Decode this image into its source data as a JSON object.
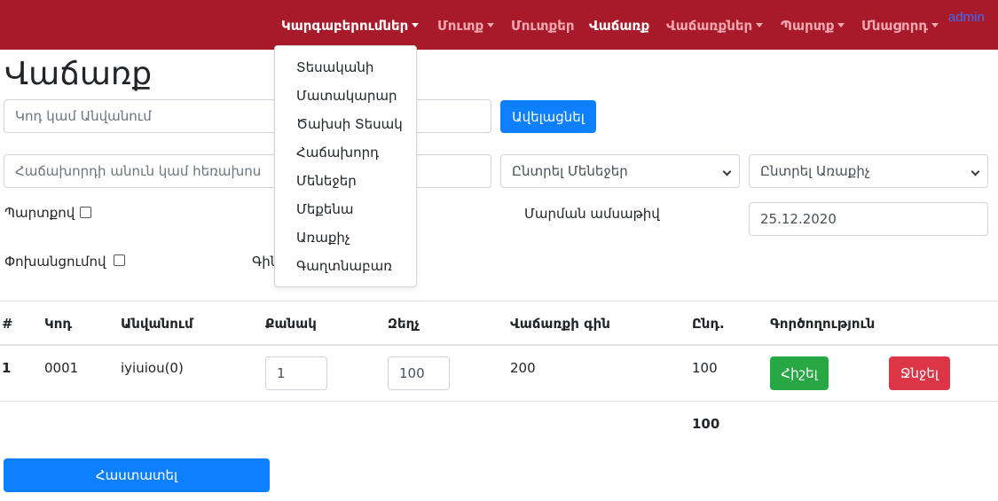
{
  "navbar": {
    "items": [
      {
        "label": "Կարգաբերումներ",
        "dropdown": true,
        "active": true
      },
      {
        "label": "Մուտք",
        "dropdown": true,
        "active": false
      },
      {
        "label": "Մուտքեր",
        "dropdown": false,
        "active": false
      },
      {
        "label": "Վաճառք",
        "dropdown": false,
        "active": true
      },
      {
        "label": "Վաճառքներ",
        "dropdown": true,
        "active": false
      },
      {
        "label": "Պարտք",
        "dropdown": true,
        "active": false
      },
      {
        "label": "Մնացորդ",
        "dropdown": true,
        "active": false
      }
    ],
    "user": "admin",
    "colors": {
      "background": "#a81a2a",
      "active_text": "#ffffff",
      "inactive_text": "#f0a8b0"
    }
  },
  "dropdown": {
    "items": [
      "Տեսականի",
      "Մատակարար",
      "Ծախսի Տեսակ",
      "Հաճախորդ",
      "Մենեջեր",
      "Մեքենա",
      "Առաքիչ",
      "Գաղտնաբառ"
    ]
  },
  "page": {
    "title": "Վաճառք"
  },
  "product_search": {
    "placeholder": "Կոդ կամ Անվանում",
    "value": ""
  },
  "add_button": {
    "label": "Ավելացնել"
  },
  "customer_search": {
    "placeholder": "Հաճախորդի անուն կամ հեռախոս",
    "value": ""
  },
  "manager_select": {
    "selected": "Ընտրել Մենեջեր"
  },
  "courier_select": {
    "selected": "Ընտրել Առաքիչ"
  },
  "debt_checkbox": {
    "label": "Պարտքով",
    "checked": false
  },
  "transfer_checkbox": {
    "label": "Փոխանցումով",
    "checked": false
  },
  "price_label_partial": "Գին",
  "payment_date": {
    "label": "Մարման ամսաթիվ",
    "value": "25.12.2020"
  },
  "table": {
    "headers": [
      "#",
      "Կոդ",
      "Անվանում",
      "Քանակ",
      "Զեղչ",
      "Վաճառքի գին",
      "Ընդ.",
      "Գործողություն"
    ],
    "rows": [
      {
        "index": "1",
        "code": "0001",
        "name": "iyiuiou(0)",
        "quantity": "1",
        "discount": "100",
        "sale_price": "200",
        "total": "100",
        "edit_label": "Հիշել",
        "delete_label": "Ջնջել"
      }
    ],
    "grand_total": "100"
  },
  "confirm_button": {
    "label": "Հաստատել"
  },
  "colors": {
    "primary": "#0d80ff",
    "success": "#28a745",
    "danger": "#dc3545"
  }
}
